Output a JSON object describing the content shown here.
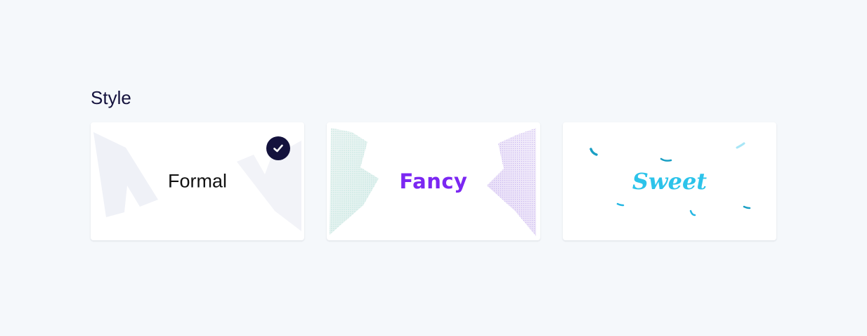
{
  "section": {
    "title": "Style"
  },
  "style_options": [
    {
      "label": "Formal",
      "selected": true,
      "color": "#111111"
    },
    {
      "label": "Fancy",
      "selected": false,
      "color": "#7b27f2"
    },
    {
      "label": "Sweet",
      "selected": false,
      "color": "#2cc3ea"
    }
  ],
  "colors": {
    "background": "#f5f8fb",
    "card": "#ffffff",
    "accent_dark": "#14123d"
  },
  "icons": {
    "selected": "check-circle-icon"
  }
}
